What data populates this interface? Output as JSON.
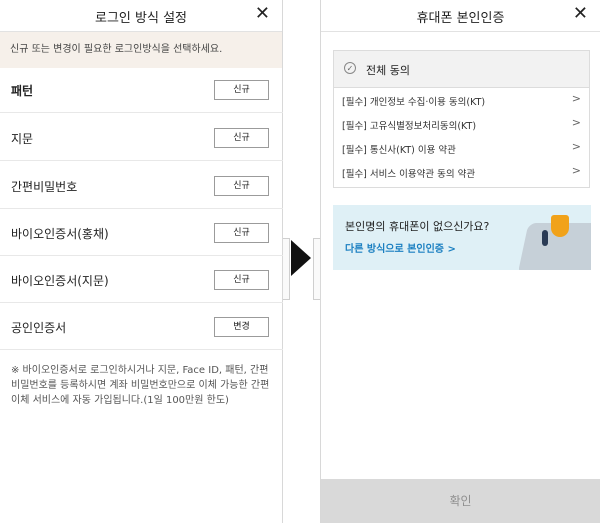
{
  "left": {
    "title": "로그인 방식 설정",
    "close": "✕",
    "notice": "신규 또는 변경이 필요한 로그인방식을 선택하세요.",
    "rows": [
      {
        "label": "패턴",
        "button": "신규"
      },
      {
        "label": "지문",
        "button": "신규"
      },
      {
        "label": "간편비밀번호",
        "button": "신규"
      },
      {
        "label": "바이오인증서(홍채)",
        "button": "신규"
      },
      {
        "label": "바이오인증서(지문)",
        "button": "신규"
      },
      {
        "label": "공인인증서",
        "button": "변경"
      }
    ],
    "note": "※ 바이오인증서로 로그인하시거나 지문, Face ID, 패턴, 간편비밀번호를 등록하시면 계좌 비밀번호만으로 이체 가능한 간편이체 서비스에 자동 가입됩니다.(1일 100만원 한도)"
  },
  "right": {
    "title": "휴대폰 본인인증",
    "close": "✕",
    "agree_all": "전체 동의",
    "terms": [
      "[필수] 개인정보 수집·이용 동의(KT)",
      "[필수] 고유식별정보처리동의(KT)",
      "[필수] 통신사(KT) 이용 약관",
      "[필수] 서비스 이용약관 동의 약관"
    ],
    "banner_question": "본인명의 휴대폰이 없으신가요?",
    "banner_link": "다른 방식으로 본인인증 >",
    "confirm": "확인"
  },
  "icons": {
    "close": "close-icon",
    "check": "check-circle-icon",
    "chevron": "chevron-right-icon",
    "arrow": "play-arrow-icon"
  },
  "colors": {
    "notice_bg": "#f6f0ea",
    "link": "#1a7fc1",
    "banner_bg": "#dff0f6",
    "confirm_bg": "#d9d9d9"
  }
}
